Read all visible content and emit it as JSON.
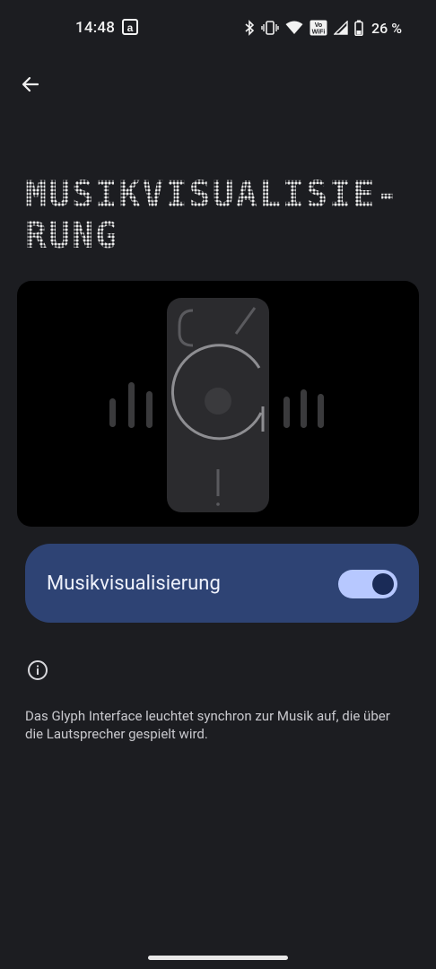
{
  "status_bar": {
    "time": "14:48",
    "battery_percent": "26 %",
    "icons": [
      "amazon-notification-icon",
      "bluetooth-icon",
      "vibrate-icon",
      "wifi-icon",
      "vowifi-icon",
      "signal-icon",
      "battery-icon"
    ],
    "vowifi_text": [
      "Vo",
      "WiFi"
    ]
  },
  "header": {
    "back_icon": "arrow-left-icon",
    "title_line1": "MUSIKVISUALISIE-",
    "title_line2": "RUNG"
  },
  "illustration": {
    "description_icon": "glyph-phone-illustration"
  },
  "setting": {
    "label": "Musikvisualisierung",
    "enabled": true
  },
  "info": {
    "icon": "info-icon",
    "text": "Das Glyph Interface leuchtet synchron zur Musik auf, die über die Lautsprecher gespielt wird."
  },
  "colors": {
    "background": "#1c1d21",
    "card": "#2e4374",
    "switch_track": "#b7c8ff",
    "switch_knob": "#1a2b57"
  }
}
